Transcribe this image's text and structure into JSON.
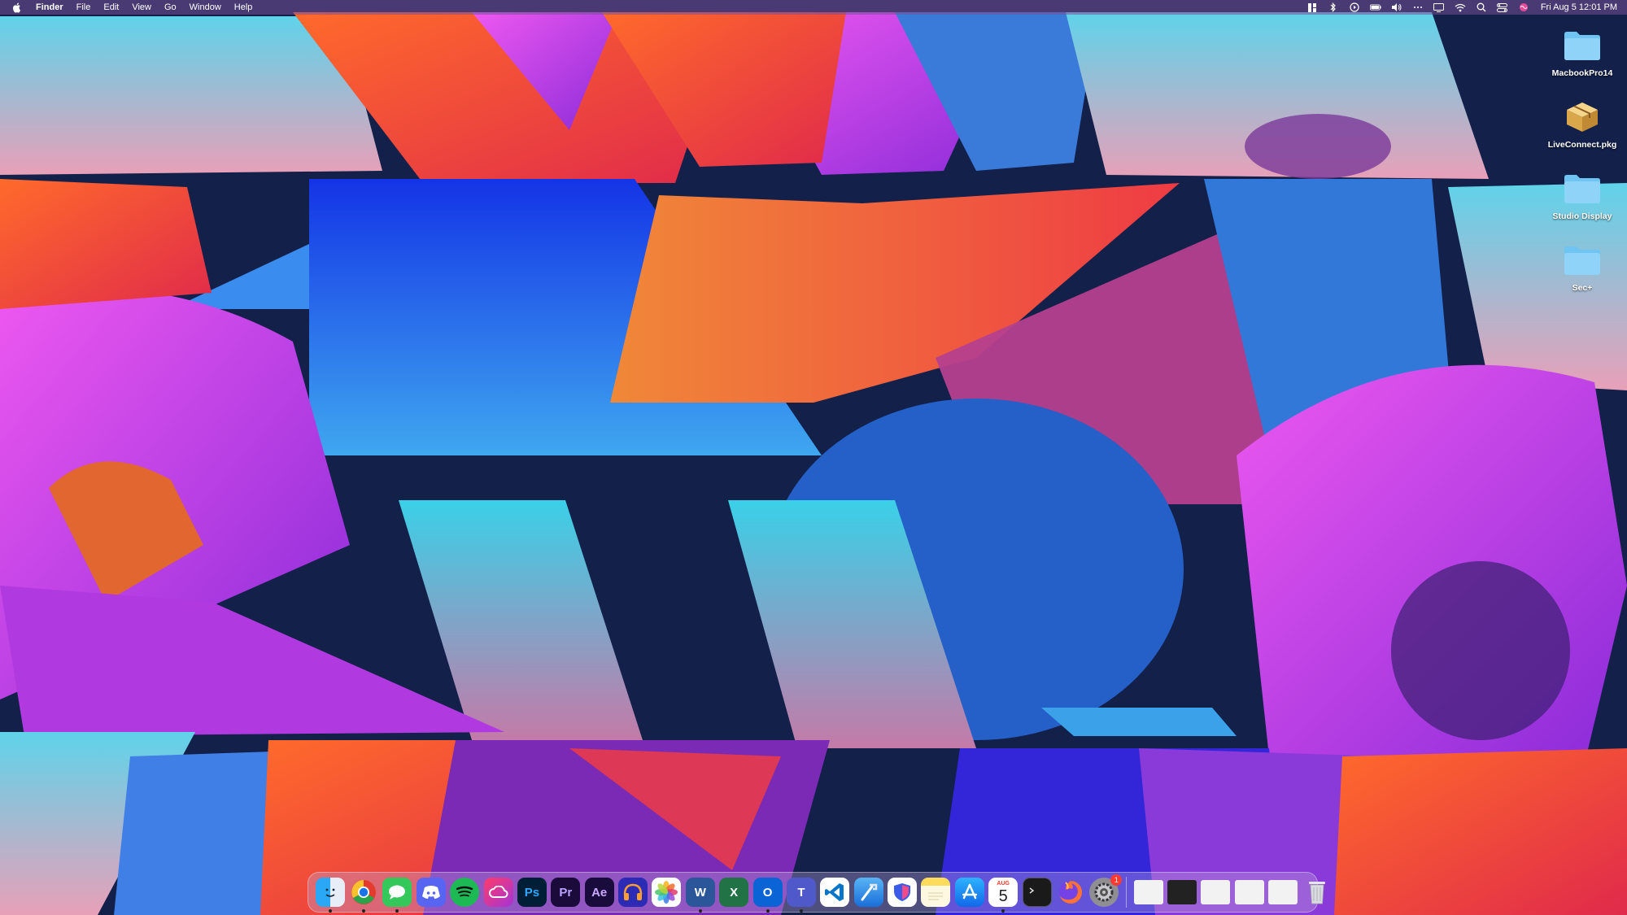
{
  "menubar": {
    "app_name": "Finder",
    "menus": [
      "File",
      "Edit",
      "View",
      "Go",
      "Window",
      "Help"
    ],
    "clock": "Fri Aug 5  12:01 PM",
    "status_icons": [
      "widget-icon",
      "bluetooth-icon",
      "play-icon",
      "battery-icon",
      "volume-icon",
      "more-icon",
      "display-icon",
      "wifi-icon",
      "search-icon",
      "control-center-icon",
      "siri-icon"
    ]
  },
  "desktop": {
    "icons": [
      {
        "label": "MacbookPro14",
        "icon": "folder-icon"
      },
      {
        "label": "LiveConnect.pkg",
        "icon": "package-icon"
      },
      {
        "label": "Studio Display",
        "icon": "folder-icon"
      },
      {
        "label": "Sec+",
        "icon": "folder-icon"
      }
    ]
  },
  "dock": {
    "apps": [
      {
        "name": "finder",
        "glyph": "",
        "color": "#2d8cf0",
        "running": true
      },
      {
        "name": "chrome",
        "glyph": "",
        "color": "#ffffff",
        "running": true
      },
      {
        "name": "messages",
        "glyph": "",
        "color": "#34c759",
        "running": true
      },
      {
        "name": "discord",
        "glyph": "",
        "color": "#5865f2",
        "running": false
      },
      {
        "name": "spotify",
        "glyph": "",
        "color": "#1db954",
        "running": false
      },
      {
        "name": "creative-cloud",
        "glyph": "",
        "color": "#e0245e",
        "running": false
      },
      {
        "name": "photoshop",
        "glyph": "Ps",
        "color": "#001e36",
        "running": false
      },
      {
        "name": "premiere-pro",
        "glyph": "Pr",
        "color": "#1b0b3b",
        "running": false
      },
      {
        "name": "after-effects",
        "glyph": "Ae",
        "color": "#1a0b3d",
        "running": false
      },
      {
        "name": "headphones-app",
        "glyph": "",
        "color": "#2b2bb5",
        "running": false
      },
      {
        "name": "photos",
        "glyph": "",
        "color": "#ffffff",
        "running": false
      },
      {
        "name": "word",
        "glyph": "W",
        "color": "#2b579a",
        "running": true
      },
      {
        "name": "excel",
        "glyph": "X",
        "color": "#217346",
        "running": false
      },
      {
        "name": "outlook",
        "glyph": "O",
        "color": "#0a64d6",
        "running": true
      },
      {
        "name": "teams",
        "glyph": "T",
        "color": "#5059c9",
        "running": true
      },
      {
        "name": "vscode",
        "glyph": "",
        "color": "#0a74c7",
        "running": false
      },
      {
        "name": "xcode",
        "glyph": "",
        "color": "#3a8ee6",
        "running": false
      },
      {
        "name": "bitwarden-shield",
        "glyph": "",
        "color": "#ffffff",
        "running": false
      },
      {
        "name": "notes",
        "glyph": "",
        "color": "#fddc5c",
        "running": false
      },
      {
        "name": "app-store",
        "glyph": "",
        "color": "#1a8cff",
        "running": false
      },
      {
        "name": "calendar",
        "glyph": "5",
        "color": "#ffffff",
        "running": true
      },
      {
        "name": "terminal",
        "glyph": "",
        "color": "#1a1a1a",
        "running": false
      },
      {
        "name": "firefox",
        "glyph": "",
        "color": "#ff7139",
        "running": false
      },
      {
        "name": "system-settings",
        "glyph": "",
        "color": "#8e8e93",
        "running": false,
        "badge": "1"
      }
    ],
    "calendar_month": "AUG",
    "recents": [
      "window-thumb-1",
      "window-thumb-2",
      "window-thumb-3",
      "window-thumb-4",
      "window-thumb-5"
    ],
    "trash": "trash-icon"
  }
}
